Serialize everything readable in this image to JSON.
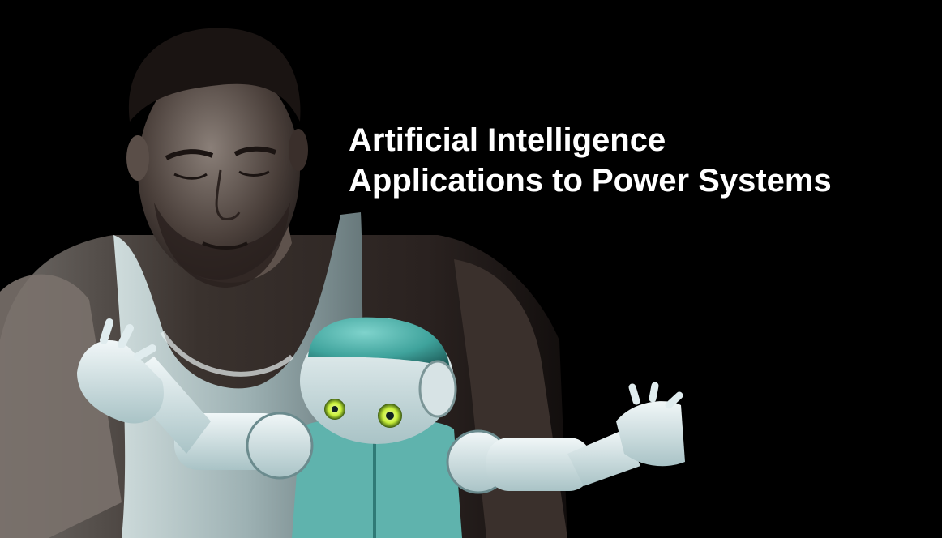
{
  "title": {
    "line1": "Artificial Intelligence",
    "line2": "Applications to Power Systems"
  },
  "scene": {
    "background_color": "#000000",
    "subject": "man-with-humanoid-robot",
    "robot_accent_color": "#4fb3ad",
    "robot_eye_color": "#c8f03a"
  }
}
